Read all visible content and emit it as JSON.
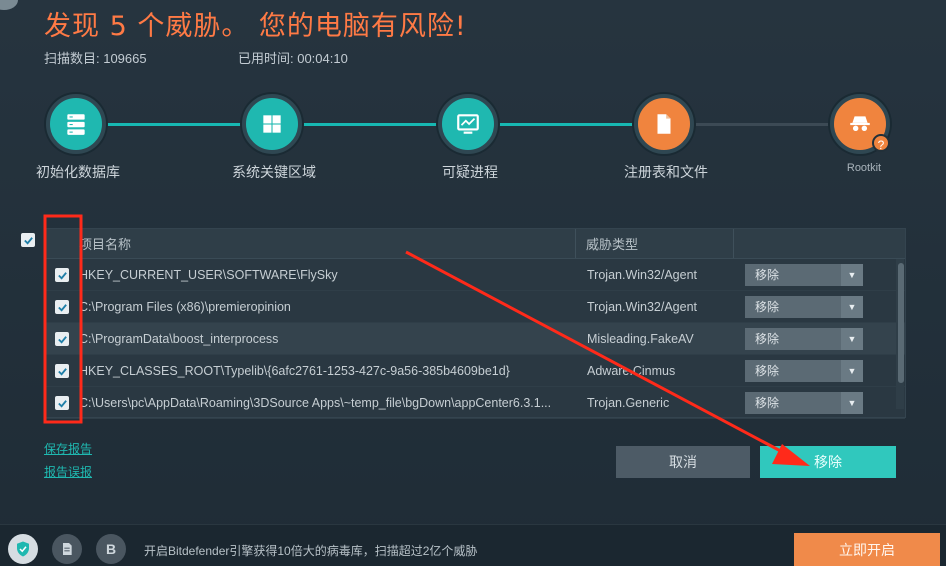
{
  "header": {
    "title": "发现 5 个威胁。 您的电脑有风险!",
    "scan_count": "扫描数目: 109665",
    "elapsed": "已用时间: 00:04:10"
  },
  "steps": [
    {
      "label": "初始化数据库",
      "icon": "database-icon",
      "state": "done"
    },
    {
      "label": "系统关键区域",
      "icon": "windows-icon",
      "state": "done"
    },
    {
      "label": "可疑进程",
      "icon": "monitor-icon",
      "state": "done"
    },
    {
      "label": "注册表和文件",
      "icon": "document-icon",
      "state": "warning"
    },
    {
      "label": "Rootkit",
      "icon": "spy-icon",
      "state": "warning",
      "badge": "?"
    }
  ],
  "table": {
    "col_name": "项目名称",
    "col_type": "威胁类型",
    "rows": [
      {
        "path": "HKEY_CURRENT_USER\\SOFTWARE\\FlySky",
        "type": "Trojan.Win32/Agent",
        "action": "移除",
        "checked": true
      },
      {
        "path": "C:\\Program Files (x86)\\premieropinion",
        "type": "Trojan.Win32/Agent",
        "action": "移除",
        "checked": true
      },
      {
        "path": "C:\\ProgramData\\boost_interprocess",
        "type": "Misleading.FakeAV",
        "action": "移除",
        "checked": true
      },
      {
        "path": "HKEY_CLASSES_ROOT\\Typelib\\{6afc2761-1253-427c-9a56-385b4609be1d}",
        "type": "Adware.Cinmus",
        "action": "移除",
        "checked": true
      },
      {
        "path": "C:\\Users\\pc\\AppData\\Roaming\\3DSource Apps\\~temp_file\\bgDown\\appCenter6.3.1...",
        "type": "Trojan.Generic",
        "action": "移除",
        "checked": true
      }
    ]
  },
  "links": {
    "save_report": "保存报告",
    "report_error": "报告误报"
  },
  "buttons": {
    "cancel": "取消",
    "remove": "移除"
  },
  "footer": {
    "promo_text": "开启Bitdefender引擎获得10倍大的病毒库，扫描超过2亿个威胁",
    "open_now": "立即开启",
    "b_icon": "B"
  },
  "colors": {
    "accent": "#1fb8b0",
    "warning": "#f0843e",
    "title": "#ff7a45",
    "annotation": "#ff2a1a"
  }
}
